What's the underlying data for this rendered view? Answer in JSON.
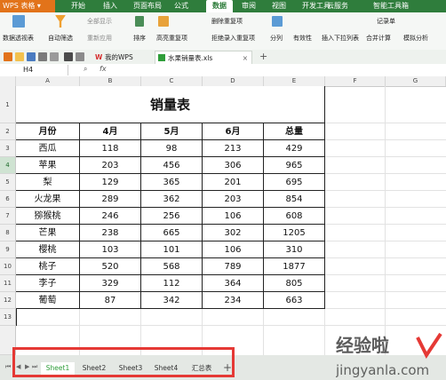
{
  "menubar": {
    "app_name": "WPS 表格",
    "tabs": [
      "开始",
      "插入",
      "页面布局",
      "公式",
      "数据",
      "审阅",
      "视图",
      "开发工具",
      "云服务",
      "智能工具箱"
    ],
    "active_tab": "数据"
  },
  "ribbon": {
    "pivot": "数据透视表",
    "autofilter": "自动筛选",
    "show_all": "全部显示",
    "reapply": "重新应用",
    "sort": "排序",
    "highlight_dup": "高亮重复项",
    "remove_dup": "删除重复项",
    "reject_dup": "拒绝录入重复项",
    "split": "分列",
    "validity": "有效性",
    "insert_dropdown": "插入下拉列表",
    "record": "记录单",
    "merge_calc": "合并计算",
    "simulate": "模拟分析"
  },
  "doc_tabs": [
    {
      "label": "我的WPS"
    },
    {
      "label": "水果销量表.xls"
    }
  ],
  "formula_bar": {
    "name_box": "H4",
    "fx": "fx"
  },
  "columns": [
    "A",
    "B",
    "C",
    "D",
    "E",
    "F",
    "G"
  ],
  "rows": [
    "1",
    "2",
    "3",
    "4",
    "5",
    "6",
    "7",
    "8",
    "9",
    "10",
    "11",
    "12",
    "13"
  ],
  "table": {
    "title": "销量表",
    "headers": [
      "月份",
      "4月",
      "5月",
      "6月",
      "总量"
    ],
    "body": [
      [
        "西瓜",
        "118",
        "98",
        "213",
        "429"
      ],
      [
        "苹果",
        "203",
        "456",
        "306",
        "965"
      ],
      [
        "梨",
        "129",
        "365",
        "201",
        "695"
      ],
      [
        "火龙果",
        "289",
        "362",
        "203",
        "854"
      ],
      [
        "猕猴桃",
        "246",
        "256",
        "106",
        "608"
      ],
      [
        "芒果",
        "238",
        "665",
        "302",
        "1205"
      ],
      [
        "樱桃",
        "103",
        "101",
        "106",
        "310"
      ],
      [
        "桃子",
        "520",
        "568",
        "789",
        "1877"
      ],
      [
        "李子",
        "329",
        "112",
        "364",
        "805"
      ],
      [
        "葡萄",
        "87",
        "342",
        "234",
        "663"
      ]
    ]
  },
  "sheet_tabs": [
    "Sheet1",
    "Sheet2",
    "Sheet3",
    "Sheet4",
    "汇总表"
  ],
  "active_sheet": "Sheet1",
  "watermark": {
    "text": "经验啦",
    "url": "jingyanla.com"
  },
  "colors": {
    "accent": "#2f7d3c",
    "app": "#e2731a",
    "highlight": "#e53935"
  }
}
